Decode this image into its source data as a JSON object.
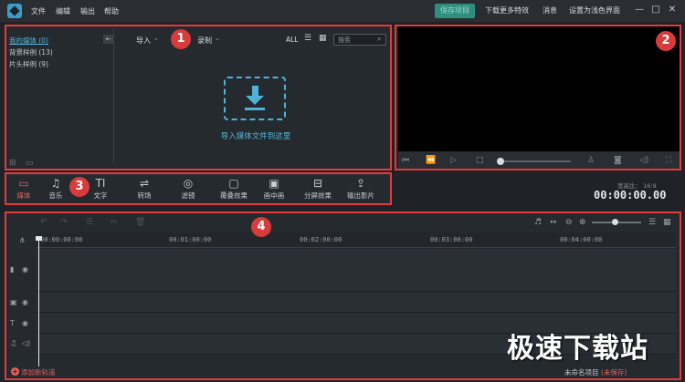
{
  "menubar": {
    "items": [
      "文件",
      "编辑",
      "输出",
      "帮助"
    ],
    "save_button": "保存项目",
    "more_effects": "下载更多特效",
    "messages": "消息",
    "theme": "设置为浅色界面",
    "window_controls": [
      "—",
      "□",
      "✕"
    ]
  },
  "media": {
    "library": [
      {
        "label": "我的媒体 (0)",
        "active": true
      },
      {
        "label": "背景样例 (13)",
        "active": false
      },
      {
        "label": "片头样例 (9)",
        "active": false
      }
    ],
    "import_label": "导入",
    "record_label": "录制",
    "filter_all": "ALL",
    "search_placeholder": "搜索",
    "drop_text": "导入媒体文件到这里"
  },
  "preview": {
    "aspect_ratio": "宽高比：  16:9",
    "timecode": "00:00:00.00"
  },
  "tools": [
    {
      "label": "媒体",
      "icon": "folder-icon",
      "glyph": "▭",
      "active": true
    },
    {
      "label": "音乐",
      "icon": "music-icon",
      "glyph": "♫",
      "active": false
    },
    {
      "label": "文字",
      "icon": "text-icon",
      "glyph": "TI",
      "active": false
    },
    {
      "label": "转场",
      "icon": "transition-icon",
      "glyph": "⇌",
      "active": false
    },
    {
      "label": "滤镜",
      "icon": "filter-icon",
      "glyph": "◎",
      "active": false
    },
    {
      "label": "覆叠效果",
      "icon": "overlay-icon",
      "glyph": "▢",
      "active": false
    },
    {
      "label": "画中画",
      "icon": "pip-icon",
      "glyph": "▣",
      "active": false
    },
    {
      "label": "分屏效果",
      "icon": "split-screen-icon",
      "glyph": "⊟",
      "active": false
    },
    {
      "label": "输出影片",
      "icon": "export-icon",
      "glyph": "⇪",
      "active": false
    }
  ],
  "timeline": {
    "ticks": [
      "00:00:00:00",
      "00:01:00:00",
      "00:02:00:00",
      "00:03:00:00",
      "00:04:00:00"
    ],
    "add_track": "添加新轨道",
    "project_name": "未命名项目",
    "unsaved": "(未保存)"
  },
  "annotations": [
    "1",
    "2",
    "3",
    "4"
  ],
  "watermark": "极速下载站",
  "colors": {
    "accent": "#4fb3d8",
    "highlight": "#e9605b",
    "annotation": "#e23b3b"
  }
}
